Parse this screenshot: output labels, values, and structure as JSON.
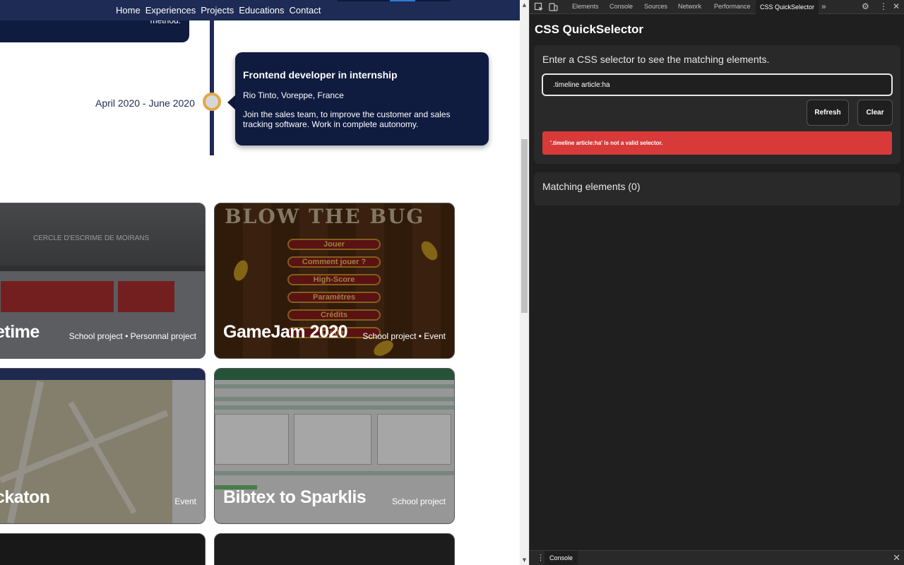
{
  "site": {
    "nav": [
      "Home",
      "Experiences",
      "Projects",
      "Educations",
      "Contact"
    ],
    "prev_entry_tail": "method.",
    "timeline_entry": {
      "date": "April 2020 - June 2020",
      "title": "Frontend developer in internship",
      "place": "Rio Tinto, Voreppe, France",
      "description": "Join the sales team, to improve the customer and sales tracking software. Work in complete autonomy."
    },
    "projects": [
      {
        "title": "Entretime",
        "visible_title": "etime",
        "tags": "School project  •  Personnal project",
        "screenshot_text": "CERCLE D'ESCRIME DE MOIRANS"
      },
      {
        "title": "GameJam 2020",
        "tags": "School project  •  Event",
        "screenshot_logo": "BLOW THE BUG",
        "menu": [
          "Jouer",
          "Comment jouer ?",
          "High-Score",
          "Paramètres",
          "Crédits",
          "Quitter"
        ]
      },
      {
        "title": "Hackaton",
        "visible_title": "ckaton",
        "tags": "Event"
      },
      {
        "title": "Bibtex to Sparklis",
        "tags": "School project"
      }
    ]
  },
  "devtools": {
    "tabs": [
      "Elements",
      "Console",
      "Sources",
      "Network",
      "Performance",
      "CSS QuickSelector"
    ],
    "active_tab": "CSS QuickSelector",
    "more_tabs_icon": "»",
    "panel": {
      "title": "CSS QuickSelector",
      "prompt": "Enter a CSS selector to see the matching elements.",
      "input_value": ".timeline article:ha",
      "refresh_label": "Refresh",
      "clear_label": "Clear",
      "error_message": "'.timeline article:ha' is not a valid selector.",
      "matching_label": "Matching elements (0)"
    },
    "drawer_tab": "Console"
  },
  "colors": {
    "navy": "#1e2b55",
    "timeline_dot_ring": "#e2a84a",
    "error_red": "#d83a3a",
    "devtools_bg": "#1f1f1f"
  }
}
